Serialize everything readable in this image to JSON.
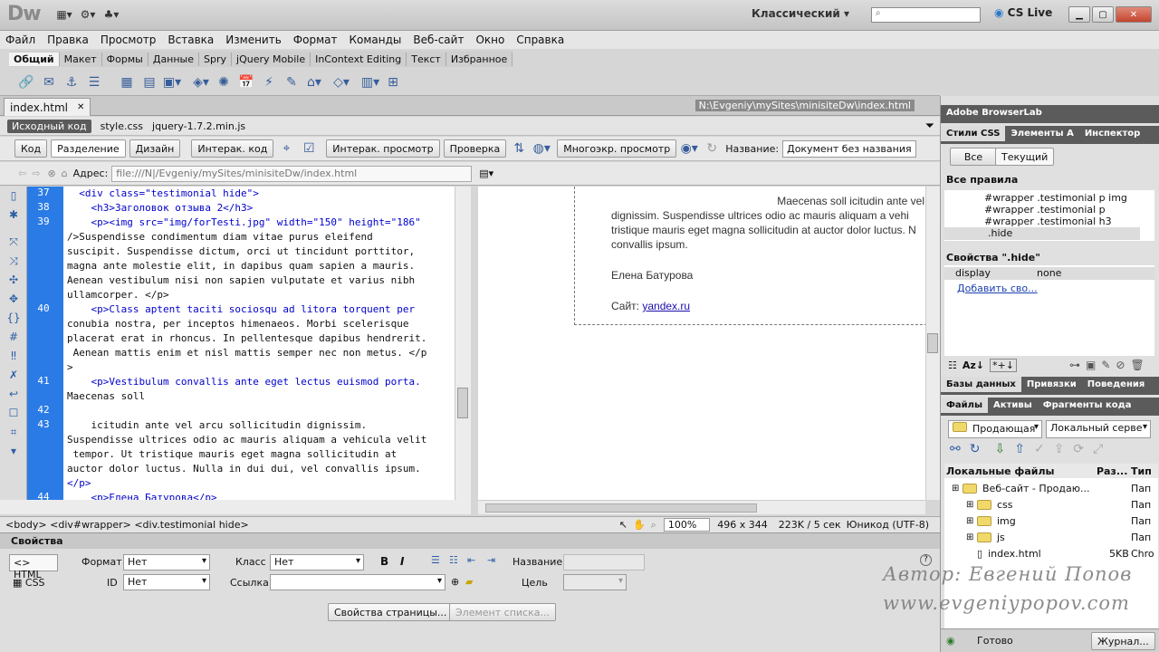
{
  "app": {
    "logo": "Dw",
    "workspace": "Классический",
    "cs_live": "CS Live"
  },
  "menu": [
    "Файл",
    "Правка",
    "Просмотр",
    "Вставка",
    "Изменить",
    "Формат",
    "Команды",
    "Веб-сайт",
    "Окно",
    "Справка"
  ],
  "insert_tabs": [
    "Общий",
    "Макет",
    "Формы",
    "Данные",
    "Spry",
    "jQuery Mobile",
    "InContext Editing",
    "Текст",
    "Избранное"
  ],
  "document": {
    "tab": "index.html",
    "path": "N:\\Evgeniy\\mySites\\minisiteDw\\index.html",
    "related": [
      "Исходный код",
      "style.css",
      "jquery-1.7.2.min.js"
    ],
    "views": {
      "code": "Код",
      "split": "Разделение",
      "design": "Дизайн",
      "live_code": "Интерак. код",
      "live_view": "Интерак. просмотр",
      "check": "Проверка",
      "multiscreen": "Многоэкр. просмотр",
      "title_label": "Название:",
      "title_value": "Документ без названия"
    },
    "address_label": "Адрес:",
    "address": "file:///N|/Evgeniy/mySites/minisiteDw/index.html"
  },
  "code_lines": [
    {
      "n": "37",
      "text": "  <div class=\"testimonial hide\">"
    },
    {
      "n": "38",
      "text": "    <h3>Заголовок отзыва 2</h3>"
    },
    {
      "n": "39",
      "text": "    <p><img src=\"img/forTesti.jpg\" width=\"150\" height=\"186\""
    },
    {
      "n": "",
      "text": "/>Suspendisse condimentum diam vitae purus eleifend"
    },
    {
      "n": "",
      "text": "suscipit. Suspendisse dictum, orci ut tincidunt porttitor,"
    },
    {
      "n": "",
      "text": "magna ante molestie elit, in dapibus quam sapien a mauris."
    },
    {
      "n": "",
      "text": "Aenean vestibulum nisi non sapien vulputate et varius nibh"
    },
    {
      "n": "",
      "text": "ullamcorper. </p>"
    },
    {
      "n": "40",
      "text": "    <p>Class aptent taciti sociosqu ad litora torquent per"
    },
    {
      "n": "",
      "text": "conubia nostra, per inceptos himenaeos. Morbi scelerisque"
    },
    {
      "n": "",
      "text": "placerat erat in rhoncus. In pellentesque dapibus hendrerit."
    },
    {
      "n": "",
      "text": " Aenean mattis enim et nisl mattis semper nec non metus. </p"
    },
    {
      "n": "",
      "text": ">"
    },
    {
      "n": "41",
      "text": "    <p>Vestibulum convallis ante eget lectus euismod porta."
    },
    {
      "n": "",
      "text": "Maecenas soll"
    },
    {
      "n": "42",
      "text": ""
    },
    {
      "n": "43",
      "text": "    icitudin ante vel arcu sollicitudin dignissim."
    },
    {
      "n": "",
      "text": "Suspendisse ultrices odio ac mauris aliquam a vehicula velit"
    },
    {
      "n": "",
      "text": " tempor. Ut tristique mauris eget magna sollicitudin at"
    },
    {
      "n": "",
      "text": "auctor dolor luctus. Nulla in dui dui, vel convallis ipsum."
    },
    {
      "n": "",
      "text": "</p>"
    },
    {
      "n": "44",
      "text": "    <p>Елена Батурова</p>"
    }
  ],
  "design_view": {
    "lines": [
      "Maecenas soll icitudin ante vel a",
      "dignissim. Suspendisse ultrices odio ac mauris aliquam a vehi",
      "tristique mauris eget magna sollicitudin at auctor dolor luctus. N",
      "convallis ipsum."
    ],
    "author": "Елена Батурова",
    "site_label": "Сайт:",
    "site_link": "yandex.ru"
  },
  "status": {
    "tags": "<body> <div#wrapper> <div.testimonial hide>",
    "zoom": "100%",
    "size": "496 x 344",
    "download": "223K / 5 сек",
    "encoding": "Юникод (UTF-8)"
  },
  "properties": {
    "title": "Свойства",
    "html": "HTML",
    "css": "CSS",
    "format_label": "Формат",
    "format_value": "Нет",
    "id_label": "ID",
    "id_value": "Нет",
    "class_label": "Класс",
    "class_value": "Нет",
    "link_label": "Ссылка",
    "name_label": "Название",
    "target_label": "Цель",
    "page_props": "Свойства страницы...",
    "list_item": "Элемент списка..."
  },
  "right_panel": {
    "browserlab": "Adobe BrowserLab",
    "css_tabs": [
      "Стили CSS",
      "Элементы A",
      "Инспектор"
    ],
    "all_btn": "Все",
    "current_btn": "Текущий",
    "all_rules": "Все правила",
    "rules": [
      "#wrapper .testimonial p img",
      "#wrapper .testimonial p",
      "#wrapper .testimonial h3",
      ".hide"
    ],
    "props_title": "Свойства \".hide\"",
    "prop_name": "display",
    "prop_value": "none",
    "add_prop": "Добавить сво...",
    "db_tabs": [
      "Базы данных",
      "Привязки",
      "Поведения"
    ],
    "file_tabs": [
      "Файлы",
      "Активы",
      "Фрагменты кода"
    ],
    "site_select": "Продающая",
    "server_select": "Локальный серве",
    "cols": [
      "Локальные файлы",
      "Раз...",
      "Тип"
    ],
    "tree": [
      {
        "name": "Веб-сайт - Продаю...",
        "size": "",
        "type": "Пап"
      },
      {
        "name": "css",
        "size": "",
        "type": "Пап"
      },
      {
        "name": "img",
        "size": "",
        "type": "Пап"
      },
      {
        "name": "js",
        "size": "",
        "type": "Пап"
      },
      {
        "name": "index.html",
        "size": "5KB",
        "type": "Chro"
      }
    ],
    "ready": "Готово",
    "log": "Журнал..."
  },
  "watermark": [
    "Автор: Евгений Попов",
    "www.evgeniypopov.com"
  ]
}
